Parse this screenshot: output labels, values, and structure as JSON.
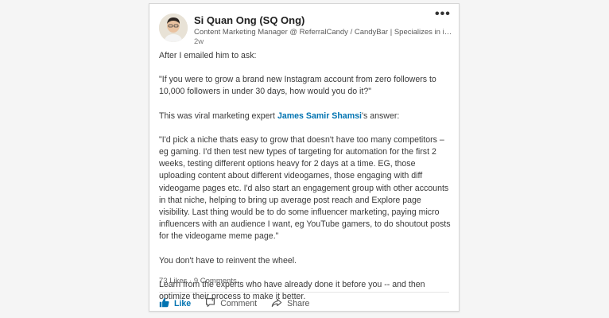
{
  "post": {
    "author_name": "Si Quan Ong (SQ Ong)",
    "author_headline": "Content Marketing Manager @ ReferralCandy / CandyBar | Specializes in improving ...",
    "time_ago": "2w",
    "more_icon": "•••",
    "paragraphs": {
      "p1": "After I emailed him to ask:",
      "p2": "\"If you were to grow a brand new Instagram account from zero followers to 10,000 followers in under 30 days, how would you do it?\"",
      "p3_before": "This was viral marketing expert ",
      "p3_mention": "James Samir Shamsi",
      "p3_after": "'s answer:",
      "p4": "\"I'd pick a niche thats easy to grow that doesn't have too many competitors – eg gaming. I'd then test new types of targeting for automation for the first 2 weeks, testing different options heavy for 2 days at a time. EG, those uploading content about different videogames, those engaging with diff videogame pages etc. I'd also start an engagement group with other accounts in that niche, helping to bring up average post reach and Explore page visibility. Last thing would be to do some influencer marketing, paying micro influencers with an audience I want, eg YouTube gamers, to do shoutout posts for the videogame meme page.\"",
      "p5": "You don't have to reinvent the wheel.",
      "p6": "Learn from the experts who have already done it before you -- and then optimize their process to make it better."
    },
    "likes": "73 Likes",
    "separator": " · ",
    "comments": "9 Comments"
  },
  "actions": {
    "like_label": "Like",
    "comment_label": "Comment",
    "share_label": "Share"
  },
  "colors": {
    "accent": "#0073b1",
    "text": "#3a3a3a",
    "muted": "#666666"
  },
  "icons": {
    "like": "thumbs-up-icon",
    "comment": "comment-icon",
    "share": "share-arrow-icon"
  }
}
